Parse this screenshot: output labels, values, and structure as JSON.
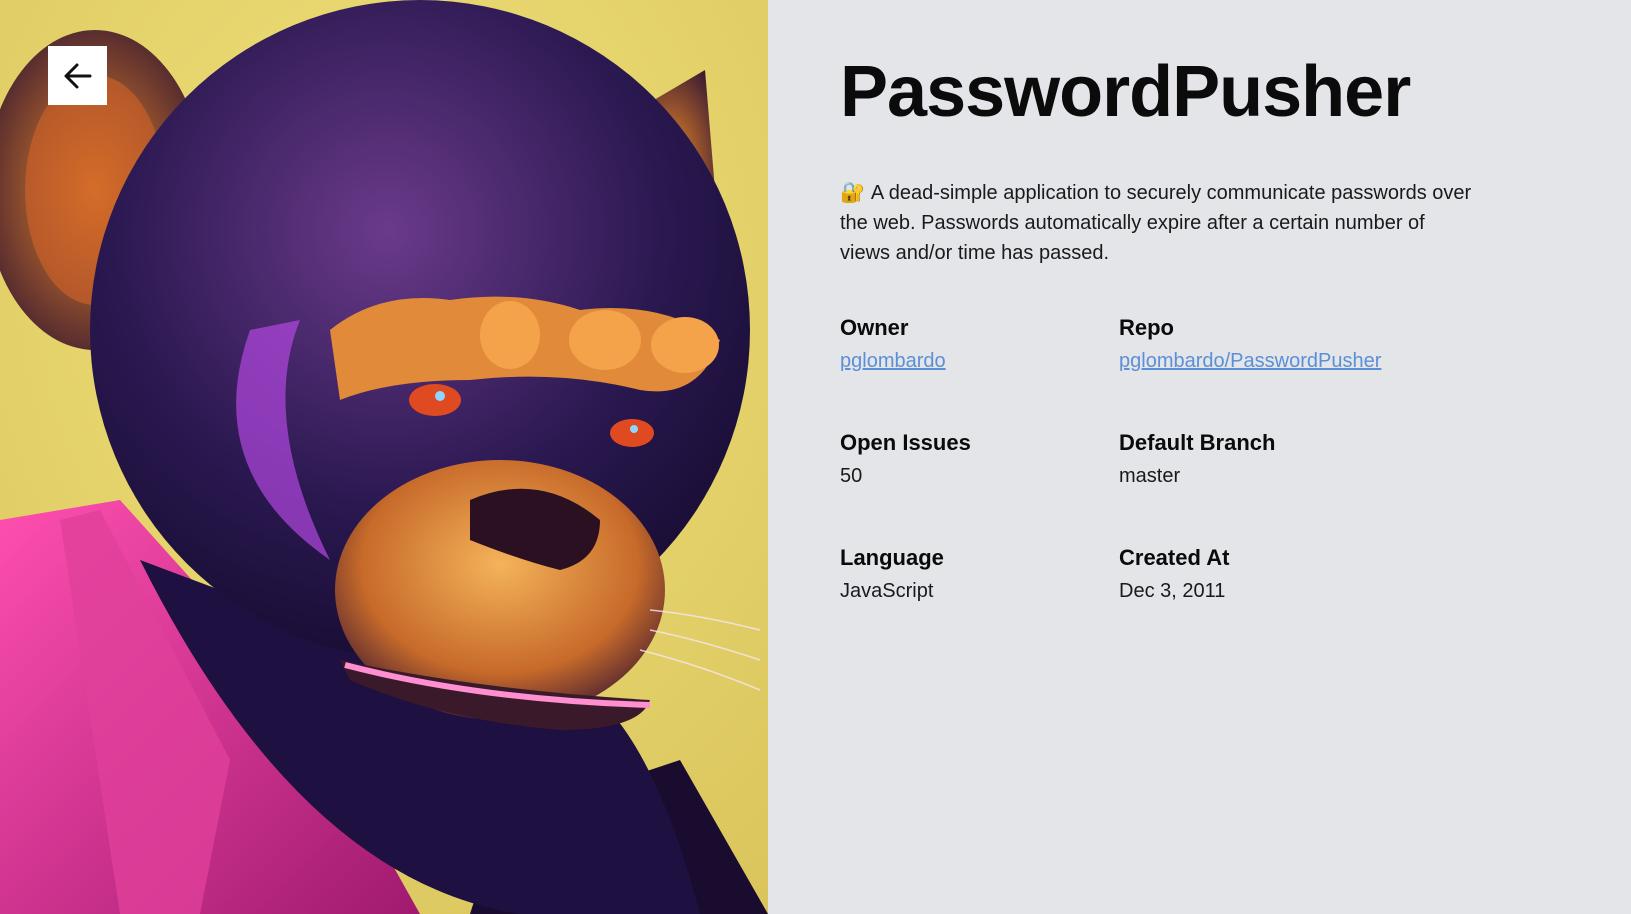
{
  "hero": {
    "alt": "Stylized portrait of an ape"
  },
  "back": {
    "icon": "arrow-left-icon"
  },
  "repo": {
    "title": "PasswordPusher",
    "description_emoji": "🔐",
    "description": "A dead-simple application to securely communicate passwords over the web. Passwords automatically expire after a certain number of views and/or time has passed."
  },
  "fields": {
    "owner": {
      "label": "Owner",
      "value": "pglombardo"
    },
    "repo": {
      "label": "Repo",
      "value": "pglombardo/PasswordPusher"
    },
    "open_issues": {
      "label": "Open Issues",
      "value": "50"
    },
    "default_branch": {
      "label": "Default Branch",
      "value": "master"
    },
    "language": {
      "label": "Language",
      "value": "JavaScript"
    },
    "created_at": {
      "label": "Created At",
      "value": "Dec 3, 2011"
    }
  },
  "colors": {
    "background": "#e4e5e9",
    "link": "#5b8fd6",
    "hero_bg": "#e2cf62"
  }
}
